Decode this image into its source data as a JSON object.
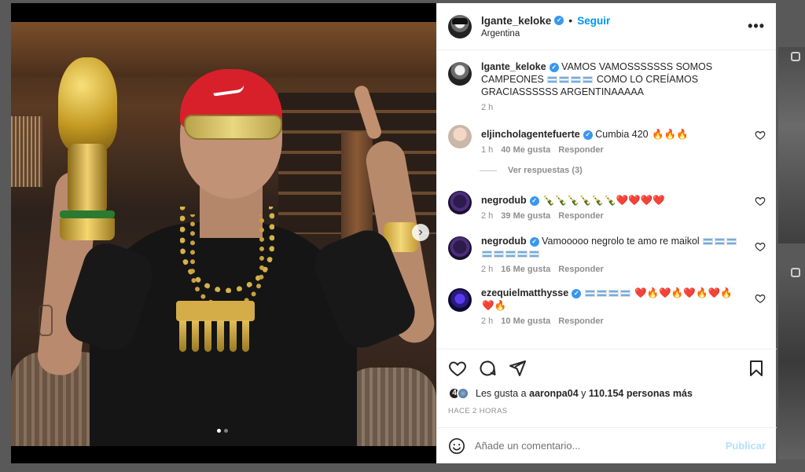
{
  "post": {
    "username": "lgante_keloke",
    "follow_label": "Seguir",
    "separator": "•",
    "location": "Argentina",
    "more_label": "•••"
  },
  "caption": {
    "username": "lgante_keloke",
    "text_1": "VAMOS VAMOSSSSSSS SOMOS CAMPEONES",
    "text_2": "COMO LO CREÍAMOS GRACIASSSSSS ARGENTINAAAAA",
    "time": "2 h"
  },
  "comments": [
    {
      "username": "eljincholagentefuerte",
      "text": "Cumbia 420",
      "emojis": "🔥🔥🔥",
      "time": "1 h",
      "likes": "40 Me gusta",
      "reply": "Responder"
    },
    {
      "username": "negrodub",
      "text": "",
      "emojis": "🍾🍾🍾🍾🍾🍾❤️❤️❤️❤️",
      "time": "2 h",
      "likes": "39 Me gusta",
      "reply": "Responder"
    },
    {
      "username": "negrodub",
      "text": "Vamooooo negrolo te amo re maikol",
      "emojis": "",
      "time": "2 h",
      "likes": "16 Me gusta",
      "reply": "Responder"
    },
    {
      "username": "ezequielmatthysse",
      "text": "",
      "emojis_a": "❤️🔥❤️🔥❤️🔥❤️🔥",
      "emojis_b": "❤️🔥",
      "time": "2 h",
      "likes": "10 Me gusta",
      "reply": "Responder"
    }
  ],
  "view_replies": "Ver respuestas (3)",
  "likes": {
    "prefix": "Les gusta a",
    "user": "aaronpa04",
    "connector": "y",
    "count": "110.154 personas más",
    "avatar_digit": "4"
  },
  "time_ago": "HACE 2 HORAS",
  "add_comment": {
    "placeholder": "Añade un comentario...",
    "post_label": "Publicar"
  },
  "carousel": {
    "current": 1,
    "total": 2,
    "next_glyph": "›"
  },
  "colors": {
    "accent": "#0095f6",
    "verified": "#3897f0",
    "post_disabled": "#b2dffc"
  },
  "icons": [
    "verified-icon",
    "more-options-icon",
    "heart-icon",
    "comment-icon",
    "share-icon",
    "bookmark-icon",
    "smiley-icon",
    "chevron-right-icon",
    "argentina-flag-icon",
    "reel-icon"
  ]
}
